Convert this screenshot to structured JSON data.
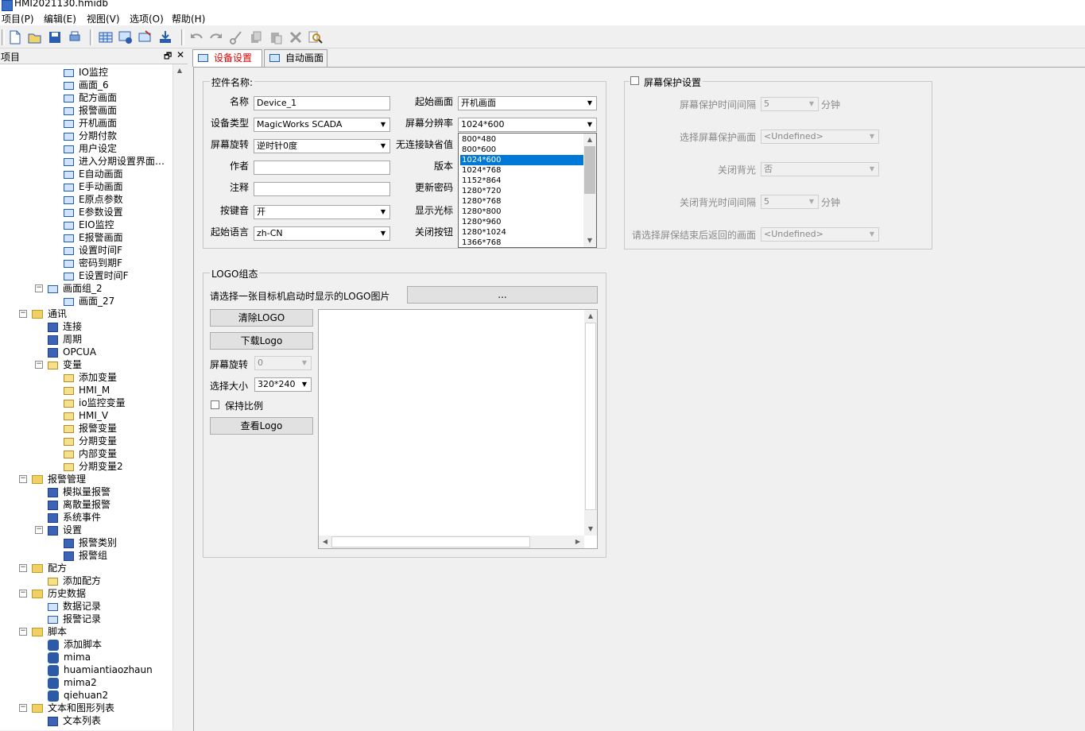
{
  "window": {
    "title": "HMI2021130.hmidb"
  },
  "menu": [
    "项目(P)",
    "编辑(E)",
    "视图(V)",
    "选项(O)",
    "帮助(H)"
  ],
  "project_panel": {
    "title": "项目",
    "pin": "🗗",
    "close": "✕",
    "tree": [
      {
        "label": "IO监控",
        "indent": 3,
        "icon": "screen"
      },
      {
        "label": "画面_6",
        "indent": 3,
        "icon": "screen"
      },
      {
        "label": "配方画面",
        "indent": 3,
        "icon": "screen"
      },
      {
        "label": "报警画面",
        "indent": 3,
        "icon": "screen"
      },
      {
        "label": "开机画面",
        "indent": 3,
        "icon": "screen"
      },
      {
        "label": "分期付款",
        "indent": 3,
        "icon": "screen"
      },
      {
        "label": "用户设定",
        "indent": 3,
        "icon": "screen"
      },
      {
        "label": "进入分期设置界面…",
        "indent": 3,
        "icon": "screen"
      },
      {
        "label": "E自动画面",
        "indent": 3,
        "icon": "screen"
      },
      {
        "label": "E手动画面",
        "indent": 3,
        "icon": "screen"
      },
      {
        "label": "E原点参数",
        "indent": 3,
        "icon": "screen"
      },
      {
        "label": "E参数设置",
        "indent": 3,
        "icon": "screen"
      },
      {
        "label": "EIO监控",
        "indent": 3,
        "icon": "screen"
      },
      {
        "label": "E报警画面",
        "indent": 3,
        "icon": "screen"
      },
      {
        "label": "设置时间F",
        "indent": 3,
        "icon": "screen"
      },
      {
        "label": "密码到期F",
        "indent": 3,
        "icon": "screen"
      },
      {
        "label": "E设置时间F",
        "indent": 3,
        "icon": "screen"
      },
      {
        "label": "画面组_2",
        "indent": 2,
        "icon": "screen",
        "expander": "−"
      },
      {
        "label": "画面_27",
        "indent": 3,
        "icon": "screen"
      },
      {
        "label": "通讯",
        "indent": 1,
        "icon": "folder",
        "expander": "−"
      },
      {
        "label": "连接",
        "indent": 2,
        "icon": "blue"
      },
      {
        "label": "周期",
        "indent": 2,
        "icon": "blue"
      },
      {
        "label": "OPCUA",
        "indent": 2,
        "icon": "blue"
      },
      {
        "label": "变量",
        "indent": 2,
        "icon": "var",
        "expander": "−"
      },
      {
        "label": "添加变量",
        "indent": 3,
        "icon": "var"
      },
      {
        "label": "HMI_M",
        "indent": 3,
        "icon": "var"
      },
      {
        "label": "io监控变量",
        "indent": 3,
        "icon": "var"
      },
      {
        "label": "HMI_V",
        "indent": 3,
        "icon": "var"
      },
      {
        "label": "报警变量",
        "indent": 3,
        "icon": "var"
      },
      {
        "label": "分期变量",
        "indent": 3,
        "icon": "var"
      },
      {
        "label": "内部变量",
        "indent": 3,
        "icon": "var"
      },
      {
        "label": "分期变量2",
        "indent": 3,
        "icon": "var"
      },
      {
        "label": "报警管理",
        "indent": 1,
        "icon": "folder",
        "expander": "−"
      },
      {
        "label": "模拟量报警",
        "indent": 2,
        "icon": "blue"
      },
      {
        "label": "离散量报警",
        "indent": 2,
        "icon": "blue"
      },
      {
        "label": "系统事件",
        "indent": 2,
        "icon": "blue"
      },
      {
        "label": "设置",
        "indent": 2,
        "icon": "blue",
        "expander": "−"
      },
      {
        "label": "报警类别",
        "indent": 3,
        "icon": "blue"
      },
      {
        "label": "报警组",
        "indent": 3,
        "icon": "blue"
      },
      {
        "label": "配方",
        "indent": 1,
        "icon": "folder",
        "expander": "−"
      },
      {
        "label": "添加配方",
        "indent": 2,
        "icon": "var"
      },
      {
        "label": "历史数据",
        "indent": 1,
        "icon": "folder",
        "expander": "−"
      },
      {
        "label": "数据记录",
        "indent": 2,
        "icon": "screen"
      },
      {
        "label": "报警记录",
        "indent": 2,
        "icon": "screen"
      },
      {
        "label": "脚本",
        "indent": 1,
        "icon": "folder",
        "expander": "−"
      },
      {
        "label": "添加脚本",
        "indent": 2,
        "icon": "script"
      },
      {
        "label": "mima",
        "indent": 2,
        "icon": "script"
      },
      {
        "label": "huamiantiaozhaun",
        "indent": 2,
        "icon": "script"
      },
      {
        "label": "mima2",
        "indent": 2,
        "icon": "script"
      },
      {
        "label": "qiehuan2",
        "indent": 2,
        "icon": "script"
      },
      {
        "label": "文本和图形列表",
        "indent": 1,
        "icon": "folder",
        "expander": "−"
      },
      {
        "label": "文本列表",
        "indent": 2,
        "icon": "blue"
      }
    ]
  },
  "tabs": [
    {
      "label": "设备设置",
      "active": true
    },
    {
      "label": "自动画面",
      "active": false
    }
  ],
  "control_group": {
    "title": "控件名称:",
    "name_label": "名称",
    "name_value": "Device_1",
    "device_type_label": "设备类型",
    "device_type_value": "MagicWorks SCADA",
    "rotation_label": "屏幕旋转",
    "rotation_value": "逆时针0度",
    "author_label": "作者",
    "author_value": "",
    "comment_label": "注释",
    "comment_value": "",
    "keytone_label": "按键音",
    "keytone_value": "开",
    "start_lang_label": "起始语言",
    "start_lang_value": "zh-CN",
    "start_screen_label": "起始画面",
    "start_screen_value": "开机画面",
    "resolution_label": "屏幕分辨率",
    "resolution_value": "1024*600",
    "no_conn_label": "无连接缺省值",
    "version_label": "版本",
    "update_pwd_label": "更新密码",
    "show_cursor_label": "显示光标",
    "close_btn_label": "关闭按钮",
    "resolution_options": [
      "800*480",
      "800*600",
      "1024*600",
      "1024*768",
      "1152*864",
      "1280*720",
      "1280*768",
      "1280*800",
      "1280*960",
      "1280*1024",
      "1366*768"
    ],
    "resolution_selected_index": 2
  },
  "screensaver_group": {
    "title": "屏幕保护设置",
    "interval_label": "屏幕保护时间间隔",
    "interval_value": "5",
    "interval_unit": "分钟",
    "select_screen_label": "选择屏幕保护画面",
    "select_screen_value": "<Undefined>",
    "backlight_label": "关闭背光",
    "backlight_value": "否",
    "backlight_interval_label": "关闭背光时间间隔",
    "backlight_interval_value": "5",
    "backlight_interval_unit": "分钟",
    "return_screen_label": "请选择屏保结束后返回的画面",
    "return_screen_value": "<Undefined>"
  },
  "logo_group": {
    "title": "LOGO组态",
    "prompt": "请选择一张目标机启动时显示的LOGO图片",
    "browse_label": "...",
    "clear_label": "清除LOGO",
    "download_label": "下载Logo",
    "rotation_label": "屏幕旋转",
    "rotation_value": "0",
    "size_label": "选择大小",
    "size_value": "320*240",
    "keep_ratio_label": "保持比例",
    "view_label": "查看Logo"
  }
}
